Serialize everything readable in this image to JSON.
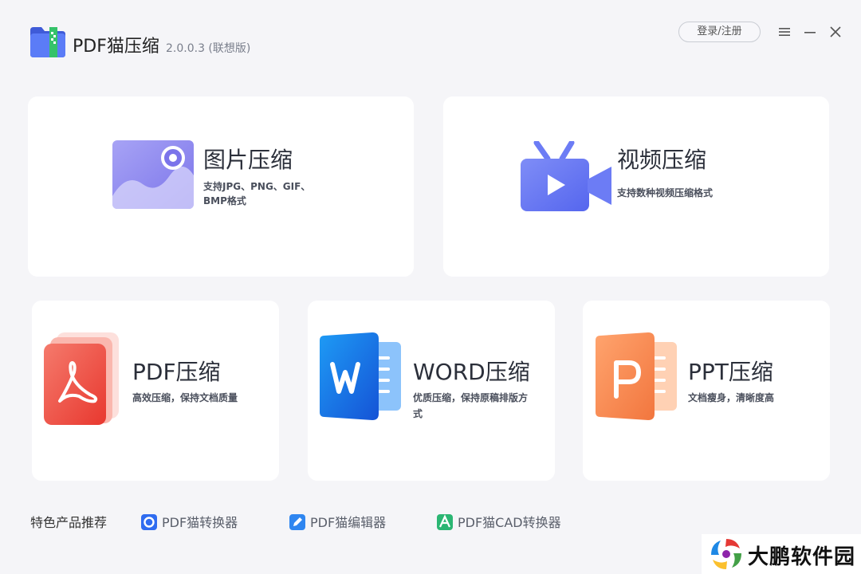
{
  "app": {
    "name": "PDF猫压缩",
    "version": "2.0.0.3 (联想版)"
  },
  "titlebar": {
    "login_label": "登录/注册",
    "menu_icon": "menu-icon",
    "minimize_icon": "minimize-icon",
    "close_icon": "close-icon"
  },
  "cards": {
    "image": {
      "title": "图片压缩",
      "desc_line1": "支持JPG、PNG、GIF、",
      "desc_line2": "BMP格式"
    },
    "video": {
      "title": "视频压缩",
      "desc": "支持数种视频压缩格式"
    },
    "pdf": {
      "title": "PDF压缩",
      "desc": "高效压缩，保持文档质量"
    },
    "word": {
      "title": "WORD压缩",
      "desc_line1": "优质压缩，保持原稿排版方",
      "desc_line2": "式"
    },
    "ppt": {
      "title": "PPT压缩",
      "desc": "文档瘦身，清晰度高"
    }
  },
  "footer": {
    "label": "特色产品推荐",
    "links": [
      {
        "label": "PDF猫转换器",
        "icon": "converter-icon"
      },
      {
        "label": "PDF猫编辑器",
        "icon": "editor-icon"
      },
      {
        "label": "PDF猫CAD转换器",
        "icon": "cad-icon"
      }
    ]
  },
  "watermark": {
    "text": "大鹏软件园"
  },
  "colors": {
    "background": "#f5f5f8",
    "card": "#ffffff",
    "image_icon": "#8a86f0",
    "video_icon": "#6c7cf5",
    "pdf_icon": "#f0524a",
    "word_icon": "#1a73e8",
    "ppt_icon": "#ff8a50"
  }
}
